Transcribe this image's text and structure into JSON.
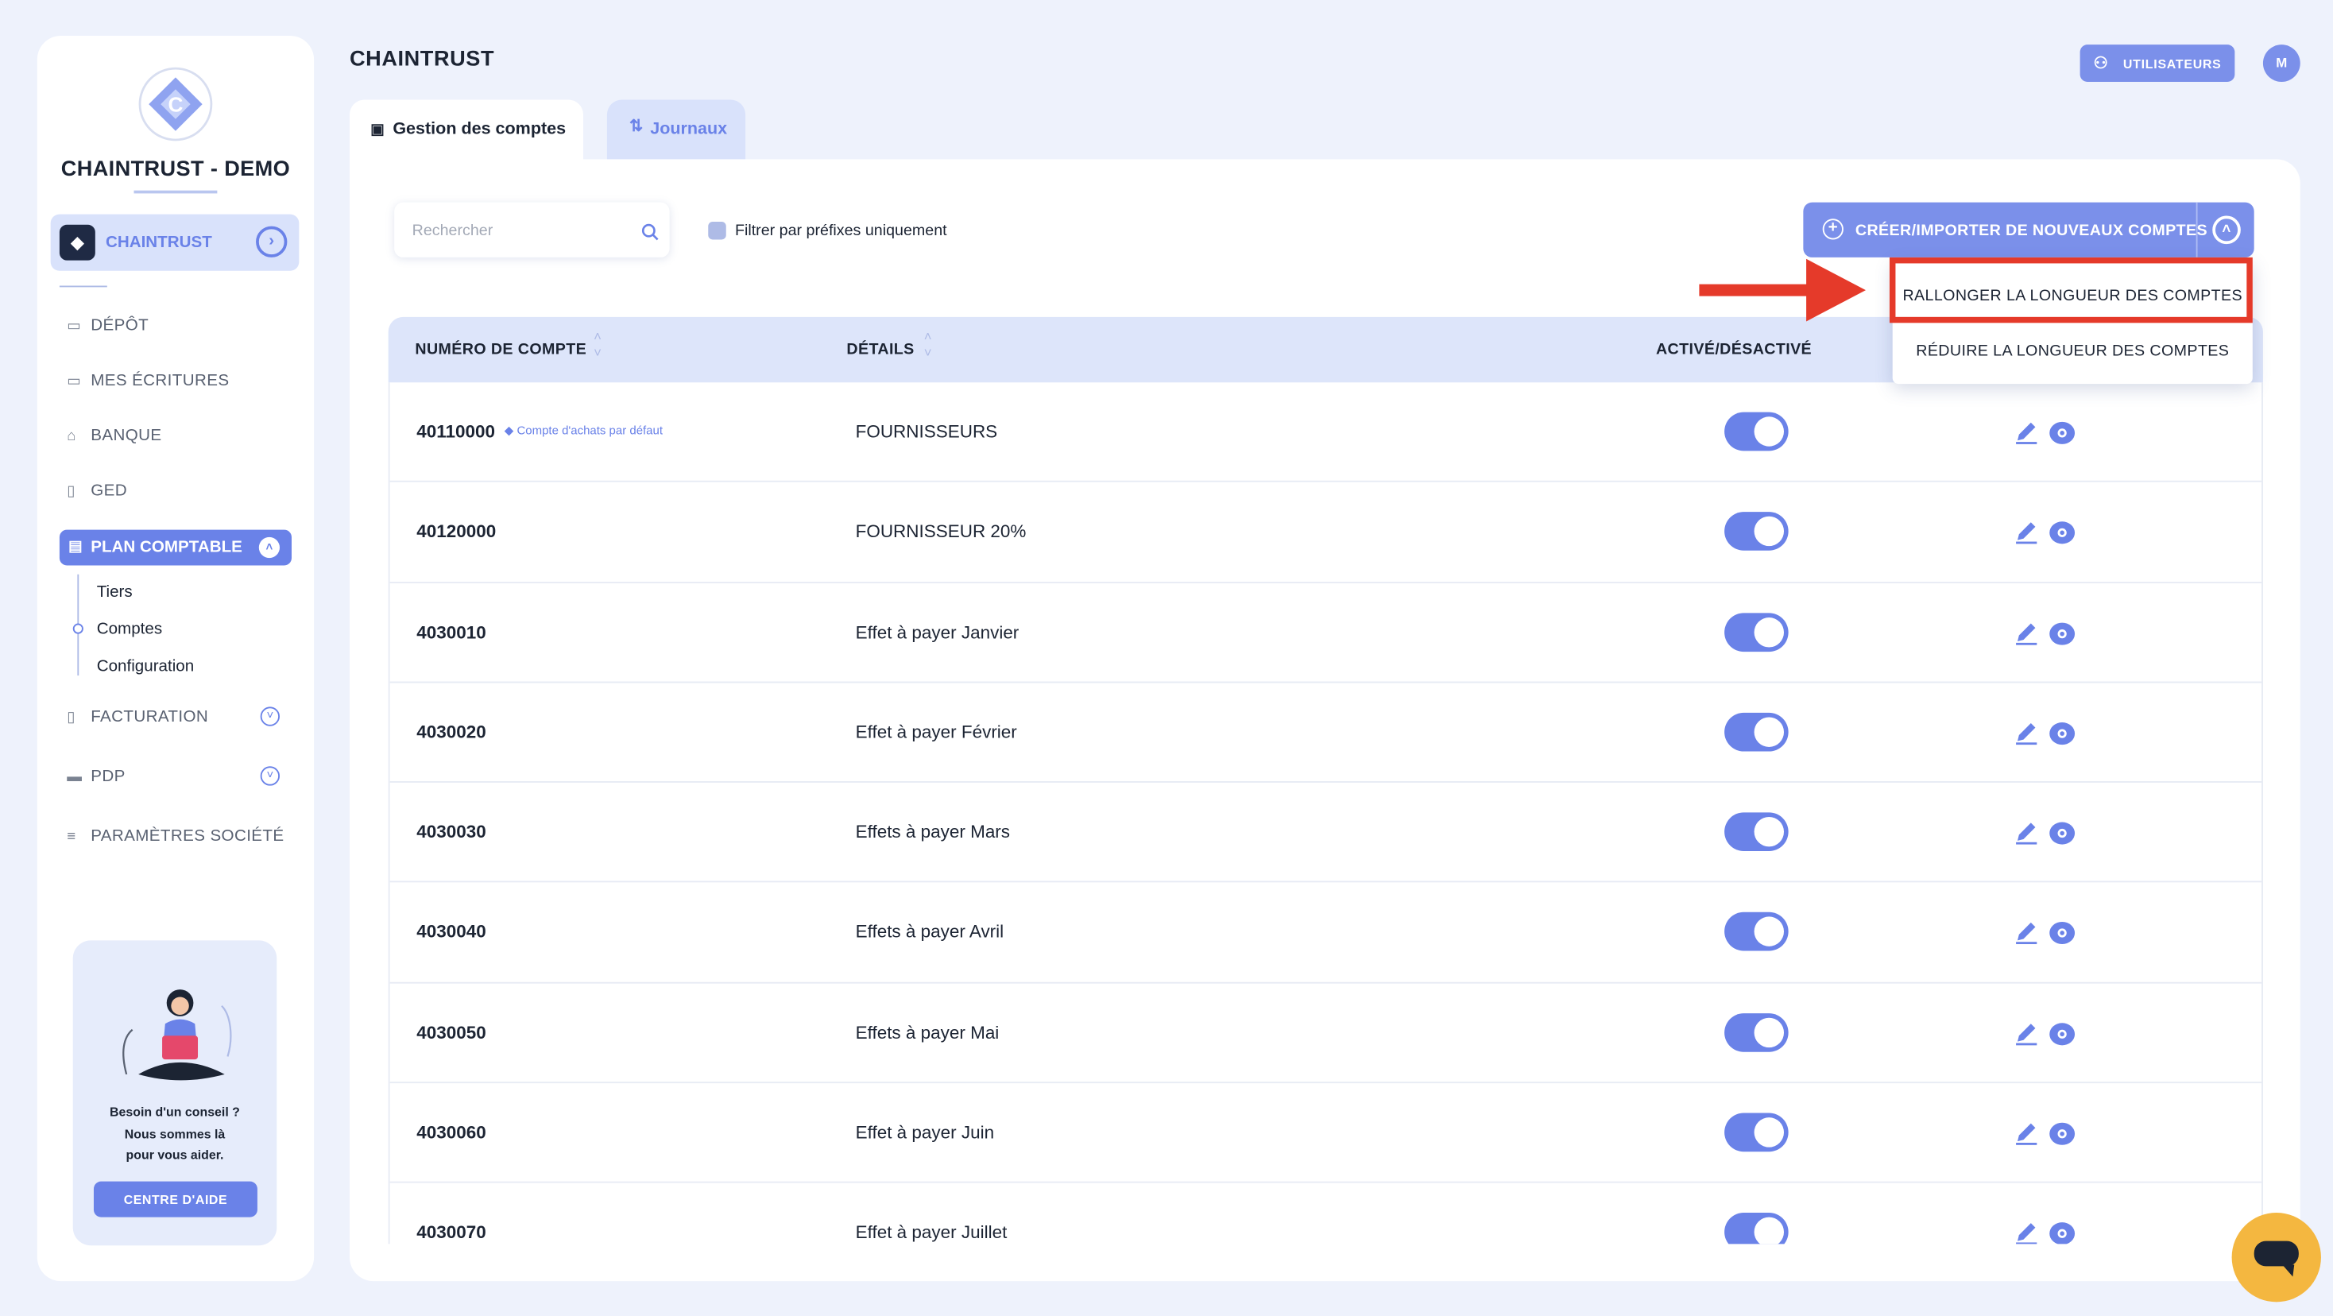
{
  "sidebar": {
    "brand": "CHAINTRUST - DEMO",
    "company": {
      "label": "CHAINTRUST"
    },
    "nav": [
      {
        "label": "DÉPÔT",
        "icon": "folder-icon"
      },
      {
        "label": "MES ÉCRITURES",
        "icon": "folder-icon"
      },
      {
        "label": "BANQUE",
        "icon": "bank-icon"
      },
      {
        "label": "GED",
        "icon": "document-icon"
      }
    ],
    "plan": {
      "label": "PLAN COMPTABLE",
      "sub": [
        "Tiers",
        "Comptes",
        "Configuration"
      ]
    },
    "nav2": [
      {
        "label": "FACTURATION",
        "icon": "invoice-icon"
      },
      {
        "label": "PDP",
        "icon": "card-icon"
      },
      {
        "label": "PARAMÈTRES SOCIÉTÉ",
        "icon": "sliders-icon"
      }
    ],
    "help": {
      "line1": "Besoin d'un conseil ?",
      "line2": "Nous sommes là",
      "line3": "pour vous aider.",
      "button": "CENTRE D'AIDE"
    }
  },
  "header": {
    "title": "CHAINTRUST",
    "users_button": "UTILISATEURS",
    "avatar": "M"
  },
  "tabs": [
    {
      "label": "Gestion des comptes",
      "active": true
    },
    {
      "label": "Journaux",
      "active": false
    }
  ],
  "toolbar": {
    "search_placeholder": "Rechercher",
    "filter_label": "Filtrer par préfixes uniquement",
    "create_button": "CRÉER/IMPORTER DE NOUVEAUX COMPTES"
  },
  "dropdown": {
    "items": [
      "RALLONGER LA LONGUEUR DES COMPTES",
      "RÉDUIRE LA LONGUEUR DES COMPTES"
    ],
    "highlighted_index": 0
  },
  "table": {
    "columns": [
      "NUMÉRO DE COMPTE",
      "DÉTAILS",
      "ACTIVÉ/DÉSACTIVÉ"
    ],
    "rows": [
      {
        "number": "40110000",
        "badge": "Compte d'achats par défaut",
        "details": "FOURNISSEURS",
        "active": true
      },
      {
        "number": "40120000",
        "badge": "",
        "details": "FOURNISSEUR 20%",
        "active": true
      },
      {
        "number": "4030010",
        "badge": "",
        "details": "Effet à payer Janvier",
        "active": true
      },
      {
        "number": "4030020",
        "badge": "",
        "details": "Effet à payer Février",
        "active": true
      },
      {
        "number": "4030030",
        "badge": "",
        "details": "Effets à payer Mars",
        "active": true
      },
      {
        "number": "4030040",
        "badge": "",
        "details": "Effets à payer Avril",
        "active": true
      },
      {
        "number": "4030050",
        "badge": "",
        "details": "Effets à payer Mai",
        "active": true
      },
      {
        "number": "4030060",
        "badge": "",
        "details": "Effet à payer Juin",
        "active": true
      },
      {
        "number": "4030070",
        "badge": "",
        "details": "Effet à payer Juillet",
        "active": true
      }
    ]
  },
  "colors": {
    "accent": "#6a82e8",
    "highlight": "#e53a2a",
    "chat": "#f4b740"
  }
}
